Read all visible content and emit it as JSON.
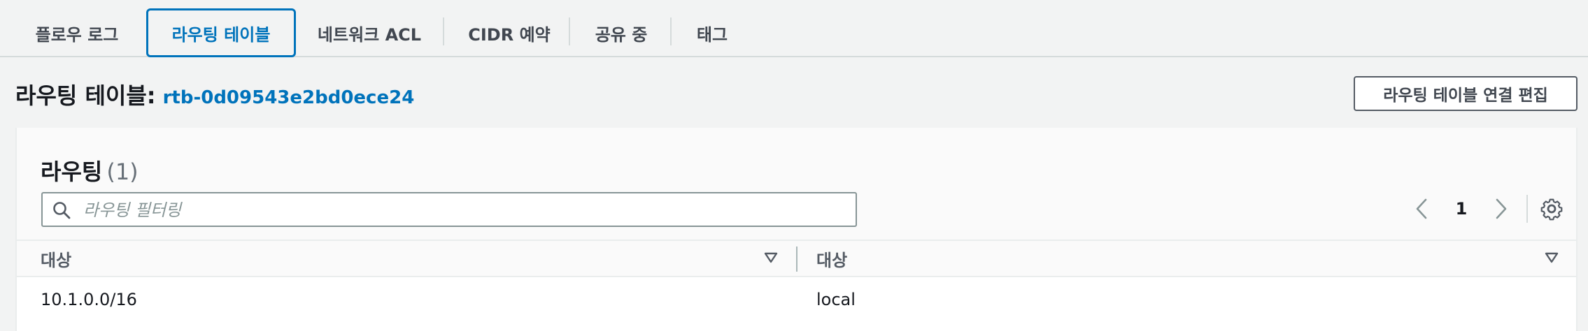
{
  "tabs": [
    {
      "label": "플로우 로그",
      "active": false
    },
    {
      "label": "라우팅 테이블",
      "active": true
    },
    {
      "label": "네트워크 ACL",
      "active": false
    },
    {
      "label": "CIDR 예약",
      "active": false
    },
    {
      "label": "공유 중",
      "active": false
    },
    {
      "label": "태그",
      "active": false
    }
  ],
  "section": {
    "title": "라우팅 테이블:",
    "route_table_id": "rtb-0d09543e2bd0ece24",
    "edit_button_label": "라우팅 테이블 연결 편집"
  },
  "routes_panel": {
    "title": "라우팅",
    "count": "(1)",
    "filter_placeholder": "라우팅 필터링",
    "filter_value": "",
    "page_number": "1",
    "columns": [
      "대상",
      "대상"
    ],
    "rows": [
      [
        "10.1.0.0/16",
        "local"
      ]
    ]
  },
  "icons": {
    "search": "search-icon",
    "prev": "chevron-left-icon",
    "next": "chevron-right-icon",
    "settings": "gear-icon",
    "sort": "sort-down-icon"
  },
  "colors": {
    "accent": "#0073bb",
    "background": "#f2f3f3",
    "border": "#d5dbdb"
  }
}
